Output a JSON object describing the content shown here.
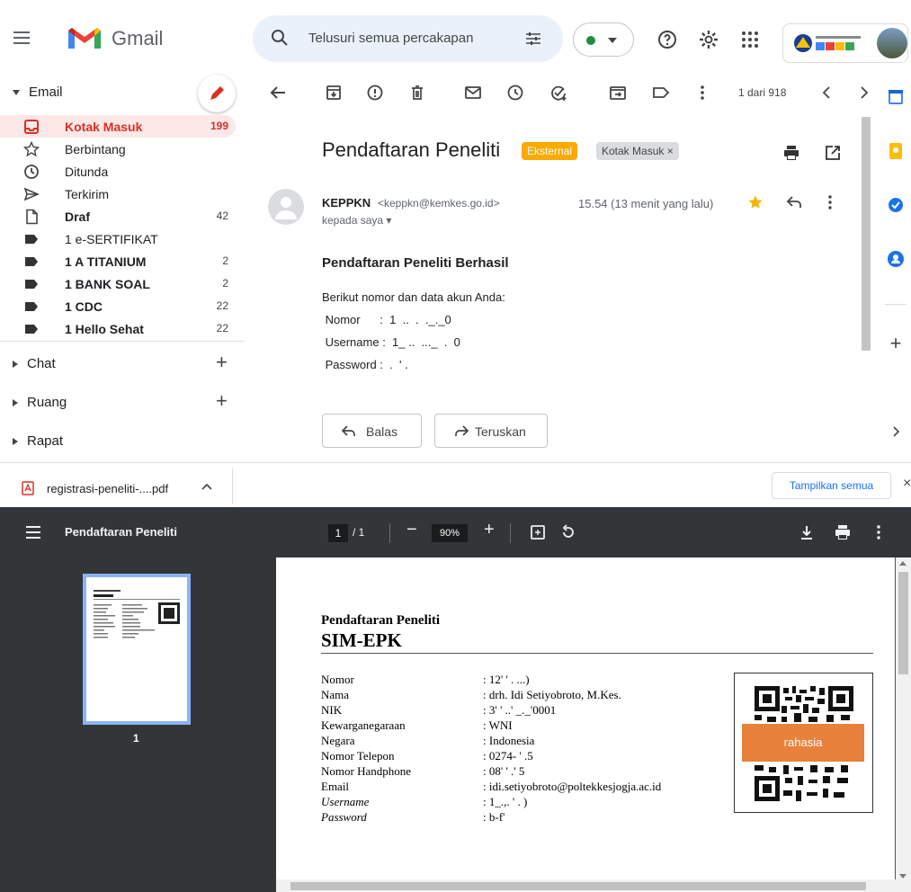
{
  "app": {
    "brand": "Gmail"
  },
  "search": {
    "placeholder": "Telusuri semua percakapan"
  },
  "sidebar": {
    "section_email": "Email",
    "items": [
      {
        "label": "Kotak Masuk",
        "count": "199"
      },
      {
        "label": "Berbintang",
        "count": ""
      },
      {
        "label": "Ditunda",
        "count": ""
      },
      {
        "label": "Terkirim",
        "count": ""
      },
      {
        "label": "Draf",
        "count": "42"
      },
      {
        "label": "1 e-SERTIFIKAT",
        "count": ""
      },
      {
        "label": "1 A TITANIUM",
        "count": "2"
      },
      {
        "label": "1 BANK SOAL",
        "count": "2"
      },
      {
        "label": "1 CDC",
        "count": "22"
      },
      {
        "label": "1 Hello Sehat",
        "count": "22"
      }
    ],
    "section_chat": "Chat",
    "section_ruang": "Ruang",
    "section_rapat": "Rapat"
  },
  "toolbar": {
    "pager": "1 dari 918"
  },
  "message": {
    "subject": "Pendaftaran Peneliti",
    "chip_external": "Eksternal",
    "chip_inbox": "Kotak Masuk ×",
    "sender_name": "KEPPKN",
    "sender_email": "<keppkn@kemkes.go.id>",
    "recipient": "kepada saya ▾",
    "timestamp": "15.54 (13 menit yang lalu)",
    "body_title": "Pendaftaran Peneliti Berhasil",
    "body_intro": "Berikut nomor dan data akun Anda:",
    "body_nomor": " Nomor      :  1  ..  .  ._._0",
    "body_username": " Username :  1_ ..  ..._  .  0",
    "body_password": " Password :  .  ' .",
    "reply_label": "Balas",
    "forward_label": "Teruskan"
  },
  "download": {
    "filename": "registrasi-peneliti-....pdf",
    "show_all": "Tampilkan semua",
    "close": "×"
  },
  "pdf": {
    "title": "Pendaftaran Peneliti",
    "page_current": "1",
    "page_total": "/ 1",
    "zoom": "90%",
    "thumb_number": "1",
    "doc_title1": "Pendaftaran Peneliti",
    "doc_title2": "SIM-EPK",
    "rows": [
      {
        "label": "Nomor",
        "value": ": 12'  '  . ...)"
      },
      {
        "label": "Nama",
        "value": ": drh. Idi Setiyobroto, M.Kes."
      },
      {
        "label": "NIK",
        "value": ": 3' ' ..'  _._'0001"
      },
      {
        "label": "Kewarganegaraan",
        "value": ": WNI"
      },
      {
        "label": "Negara",
        "value": ": Indonesia"
      },
      {
        "label": "Nomor Telepon",
        "value": ": 0274-  '  .5"
      },
      {
        "label": "Nomor Handphone",
        "value": ": 08'  '   .'  5"
      },
      {
        "label": "Email",
        "value": ": idi.setiyobroto@poltekkesjogja.ac.id"
      },
      {
        "label": "Username",
        "value": ": 1_.,.   '  .  )"
      },
      {
        "label": "Password",
        "value": ": b-f'  "
      }
    ],
    "secret_label": "rahasia"
  }
}
